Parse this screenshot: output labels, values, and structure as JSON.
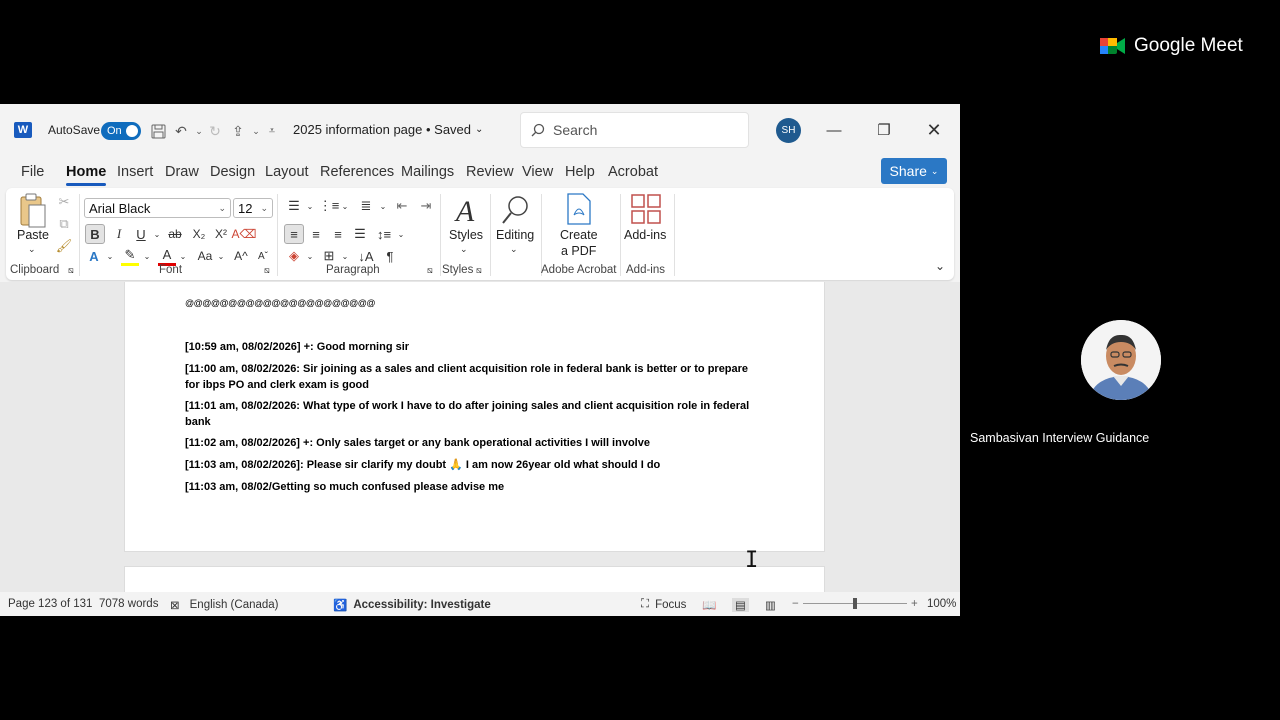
{
  "word": {
    "autosave_label": "AutoSave",
    "autosave_state": "On",
    "doc_title": "2025 information page • Saved",
    "search_placeholder": "Search",
    "user_initials": "SH",
    "menu": [
      "File",
      "Home",
      "Insert",
      "Draw",
      "Design",
      "Layout",
      "References",
      "Mailings",
      "Review",
      "View",
      "Help",
      "Acrobat"
    ],
    "share_label": "Share",
    "ribbon": {
      "paste_label": "Paste",
      "clipboard_label": "Clipboard",
      "font_name": "Arial Black",
      "font_size": "12",
      "font_label": "Font",
      "paragraph_label": "Paragraph",
      "styles_btn": "Styles",
      "styles_label": "Styles",
      "editing_btn": "Editing",
      "create_pdf_line1": "Create",
      "create_pdf_line2": "a PDF",
      "adobe_label": "Adobe Acrobat",
      "addins_btn": "Add-ins",
      "addins_label": "Add-ins"
    },
    "document": {
      "at_line": "@@@@@@@@@@@@@@@@@@@@@@",
      "lines": [
        "[10:59 am, 08/02/2026] +: Good morning sir",
        "[11:00 am, 08/02/2026: Sir joining as a sales and client acquisition role in federal bank is better or to prepare for ibps PO and clerk exam is good",
        "[11:01 am, 08/02/2026: What type of work I have to do after joining sales and client acquisition role in federal bank",
        "[11:02 am, 08/02/2026] +: Only sales target or any bank operational activities I will involve",
        "[11:03 am, 08/02/2026]: Please sir clarify my doubt 🙏 I am now 26year old what should I do",
        "[11:03 am, 08/02/Getting so much confused please advise me"
      ]
    },
    "status": {
      "page": "Page 123 of 131",
      "words": "7078 words",
      "language": "English (Canada)",
      "accessibility": "Accessibility: Investigate",
      "focus": "Focus",
      "zoom": "100%"
    }
  },
  "meet": {
    "brand": "Google Meet",
    "participant_name": "Sambasivan Interview Guidance"
  }
}
